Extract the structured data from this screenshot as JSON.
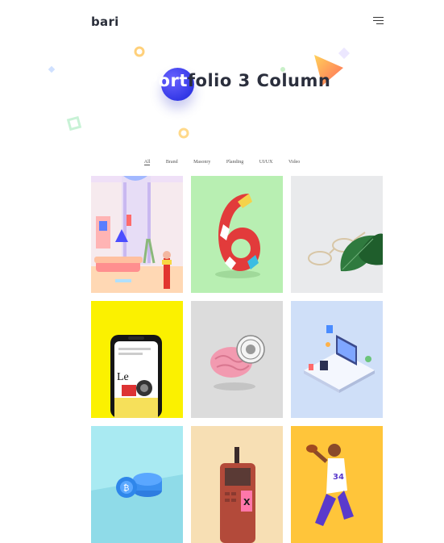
{
  "header": {
    "logo": "bari",
    "menu_icon": "hamburger-menu-icon"
  },
  "title": {
    "highlight": "Port",
    "rest": "folio 3 Column"
  },
  "filters": [
    "All",
    "Brand",
    "Masonry",
    "Planding",
    "UI/UX",
    "Video"
  ],
  "active_filter": "All",
  "portfolio": [
    {
      "name": "living-room-illustration",
      "bg": "#f3e6ea"
    },
    {
      "name": "number-six-artwork",
      "bg": "#b8efb2"
    },
    {
      "name": "glasses-and-leaf-photo",
      "bg": "#e9eaec"
    },
    {
      "name": "phone-mockup-photo",
      "bg": "#fbf100"
    },
    {
      "name": "pink-brain-sculpture",
      "bg": "#d9d9d9"
    },
    {
      "name": "isometric-workspace-illustration",
      "bg": "#cfdff8"
    },
    {
      "name": "blue-coins-render",
      "bg": "#a9eaf2"
    },
    {
      "name": "retro-phone-illustration",
      "bg": "#f7dfb4"
    },
    {
      "name": "football-player-illustration",
      "bg": "#ffc53a"
    }
  ]
}
